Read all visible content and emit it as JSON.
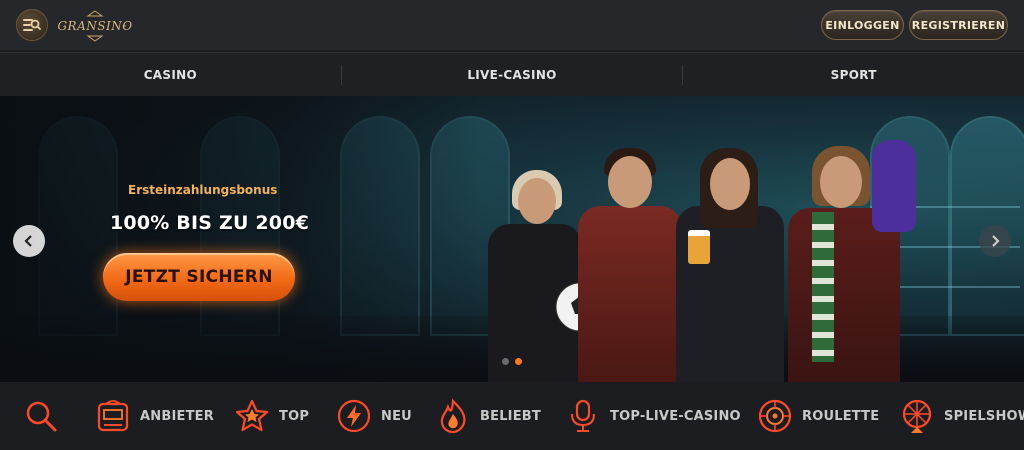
{
  "header": {
    "logo_text": "GRANSINO",
    "login_label": "EINLOGGEN",
    "register_label": "REGISTRIEREN",
    "menu_icon": "menu-search-icon"
  },
  "nav": {
    "items": [
      {
        "label": "CASINO"
      },
      {
        "label": "LIVE-CASINO"
      },
      {
        "label": "SPORT"
      }
    ]
  },
  "hero": {
    "subtitle": "Ersteinzahlungsbonus",
    "title": "100% BIS ZU 200€",
    "cta_label": "JETZT SICHERN",
    "slides_total": 2,
    "active_slide": 2,
    "accent_color": "#f36a16"
  },
  "categories": [
    {
      "label": "",
      "icon": "search-icon"
    },
    {
      "label": "ANBIETER",
      "icon": "slot-machine-icon"
    },
    {
      "label": "TOP",
      "icon": "star-icon"
    },
    {
      "label": "NEU",
      "icon": "lightning-icon"
    },
    {
      "label": "BELIEBT",
      "icon": "fire-icon"
    },
    {
      "label": "TOP-LIVE-CASINO",
      "icon": "microphone-icon"
    },
    {
      "label": "ROULETTE",
      "icon": "roulette-icon"
    },
    {
      "label": "SPIELSHOW",
      "icon": "wheel-icon"
    }
  ]
}
